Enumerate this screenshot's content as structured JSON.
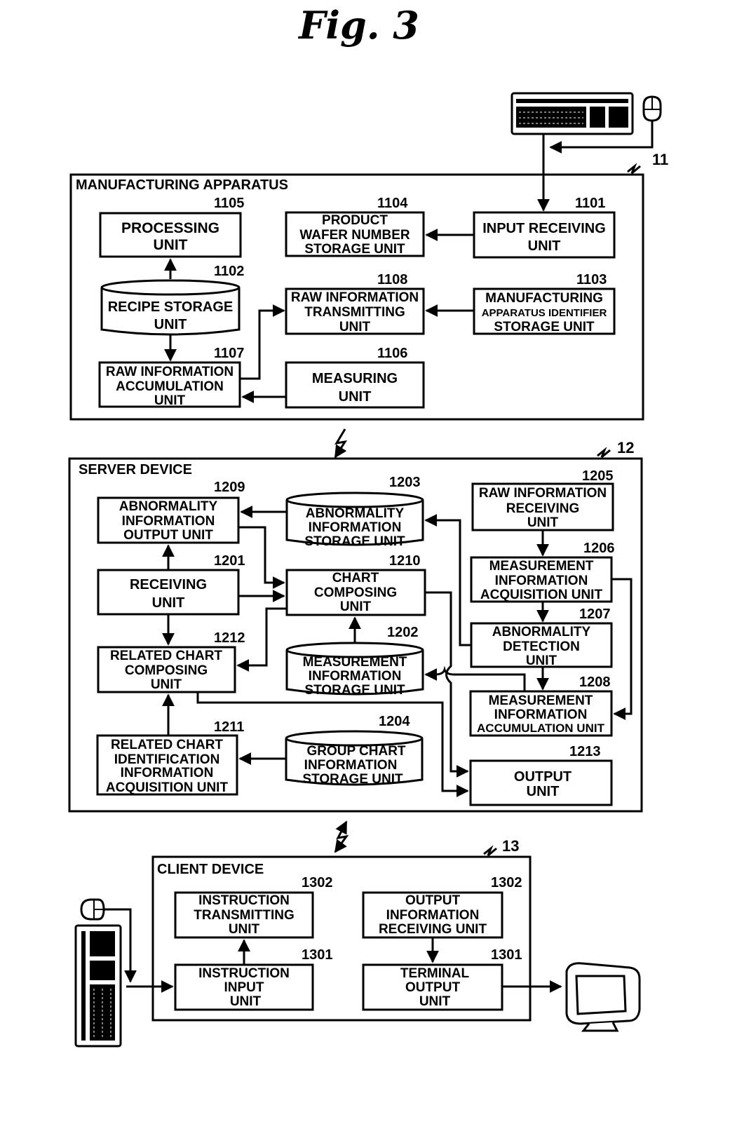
{
  "title": "Fig. 3",
  "manufacturing_apparatus": {
    "label": "MANUFACTURING APPARATUS",
    "ref": "11",
    "units": {
      "processing": {
        "ref": "1105",
        "lines": [
          "PROCESSING",
          "UNIT"
        ]
      },
      "product_wafer": {
        "ref": "1104",
        "lines": [
          "PRODUCT",
          "WAFER NUMBER",
          "STORAGE UNIT"
        ]
      },
      "input_receiving": {
        "ref": "1101",
        "lines": [
          "INPUT RECEIVING",
          "UNIT"
        ]
      },
      "recipe_storage": {
        "ref": "1102",
        "lines": [
          "RECIPE STORAGE",
          "UNIT"
        ]
      },
      "raw_info_transmitting": {
        "ref": "1108",
        "lines": [
          "RAW INFORMATION",
          "TRANSMITTING",
          "UNIT"
        ]
      },
      "ma_identifier_storage": {
        "ref": "1103",
        "lines": [
          "MANUFACTURING",
          "APPARATUS IDENTIFIER",
          "STORAGE UNIT"
        ]
      },
      "raw_info_accumulation": {
        "ref": "1107",
        "lines": [
          "RAW INFORMATION",
          "ACCUMULATION",
          "UNIT"
        ]
      },
      "measuring": {
        "ref": "1106",
        "lines": [
          "MEASURING",
          "UNIT"
        ]
      }
    }
  },
  "server_device": {
    "label": "SERVER DEVICE",
    "ref": "12",
    "units": {
      "abnormality_output": {
        "ref": "1209",
        "lines": [
          "ABNORMALITY",
          "INFORMATION",
          "OUTPUT UNIT"
        ]
      },
      "abnormality_storage": {
        "ref": "1203",
        "lines": [
          "ABNORMALITY",
          "INFORMATION",
          "STORAGE UNIT"
        ]
      },
      "raw_info_receiving": {
        "ref": "1205",
        "lines": [
          "RAW INFORMATION",
          "RECEIVING",
          "UNIT"
        ]
      },
      "receiving": {
        "ref": "1201",
        "lines": [
          "RECEIVING",
          "UNIT"
        ]
      },
      "chart_composing": {
        "ref": "1210",
        "lines": [
          "CHART",
          "COMPOSING",
          "UNIT"
        ]
      },
      "meas_acquisition": {
        "ref": "1206",
        "lines": [
          "MEASUREMENT",
          "INFORMATION",
          "ACQUISITION  UNIT"
        ]
      },
      "abnormality_detection": {
        "ref": "1207",
        "lines": [
          "ABNORMALITY",
          "DETECTION",
          "UNIT"
        ]
      },
      "related_chart_composing": {
        "ref": "1212",
        "lines": [
          "RELATED CHART",
          "COMPOSING",
          "UNIT"
        ]
      },
      "meas_storage": {
        "ref": "1202",
        "lines": [
          "MEASUREMENT",
          "INFORMATION",
          "STORAGE UNIT"
        ]
      },
      "meas_accumulation": {
        "ref": "1208",
        "lines": [
          "MEASUREMENT",
          "INFORMATION",
          "ACCUMULATION UNIT"
        ]
      },
      "related_chart_ident": {
        "ref": "1211",
        "lines": [
          "RELATED CHART",
          "IDENTIFICATION",
          "INFORMATION",
          "ACQUISITION UNIT"
        ]
      },
      "group_chart_storage": {
        "ref": "1204",
        "lines": [
          "GROUP CHART",
          "INFORMATION",
          "STORAGE UNIT"
        ]
      },
      "output": {
        "ref": "1213",
        "lines": [
          "OUTPUT",
          "UNIT"
        ]
      }
    }
  },
  "client_device": {
    "label": "CLIENT DEVICE",
    "ref": "13",
    "units": {
      "instruction_transmitting": {
        "ref": "1302",
        "lines": [
          "INSTRUCTION",
          "TRANSMITTING",
          "UNIT"
        ]
      },
      "output_info_receiving": {
        "ref": "1302",
        "lines": [
          "OUTPUT",
          "INFORMATION",
          "RECEIVING  UNIT"
        ]
      },
      "instruction_input": {
        "ref": "1301",
        "lines": [
          "INSTRUCTION",
          "INPUT",
          "UNIT"
        ]
      },
      "terminal_output": {
        "ref": "1301",
        "lines": [
          "TERMINAL",
          "OUTPUT",
          "UNIT"
        ]
      }
    }
  },
  "icons": [
    "keyboard-icon",
    "mouse-icon",
    "monitor-icon",
    "network-link-icon"
  ]
}
